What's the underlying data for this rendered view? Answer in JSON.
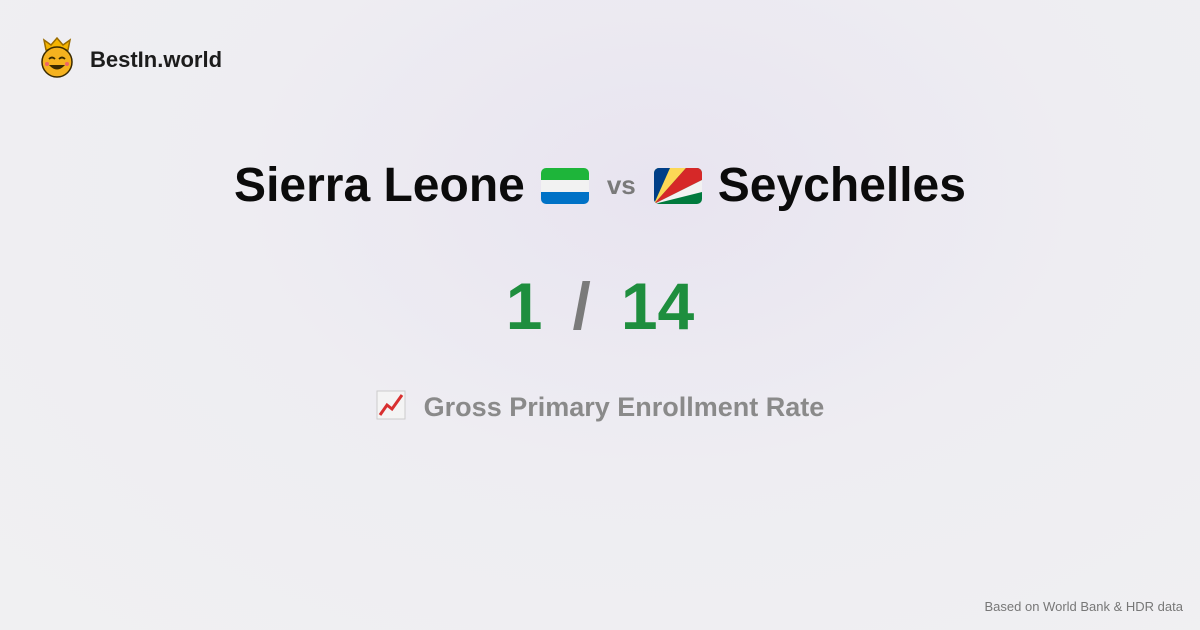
{
  "brand": {
    "name": "BestIn.world",
    "logo_icon": "crowned-smiley-icon"
  },
  "comparison": {
    "left_country": "Sierra Leone",
    "left_flag": "sierra-leone-flag-icon",
    "vs": "vs",
    "right_country": "Seychelles",
    "right_flag": "seychelles-flag-icon"
  },
  "scores": {
    "left": "1",
    "separator": "/",
    "right": "14",
    "color": "#1e8e3e"
  },
  "metric": {
    "icon": "chart-increasing-icon",
    "label": "Gross Primary Enrollment Rate"
  },
  "footer": {
    "source": "Based on World Bank & HDR data"
  }
}
